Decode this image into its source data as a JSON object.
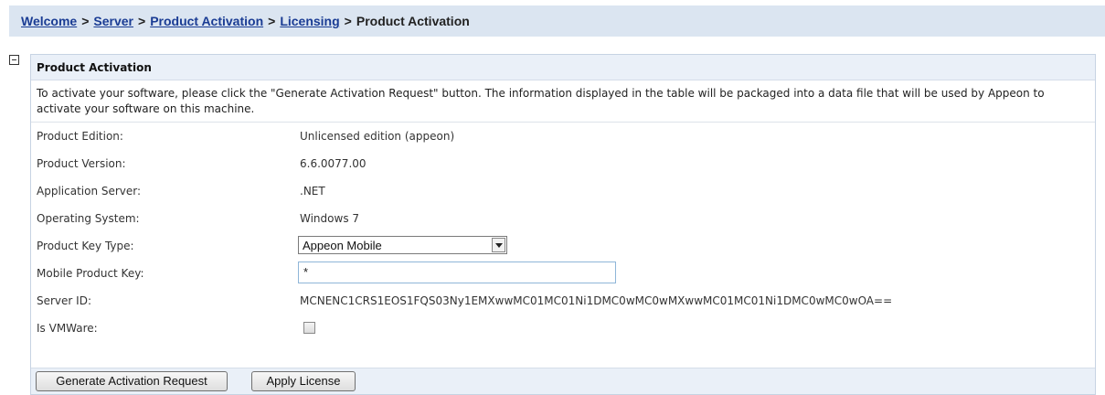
{
  "breadcrumb": {
    "items": [
      {
        "label": "Welcome",
        "link": true
      },
      {
        "label": "Server",
        "link": true
      },
      {
        "label": "Product Activation",
        "link": true
      },
      {
        "label": "Licensing",
        "link": true
      },
      {
        "label": "Product Activation",
        "link": false
      }
    ],
    "separator": ">"
  },
  "panel": {
    "title": "Product Activation",
    "description": "To activate your software, please click the \"Generate Activation Request\" button. The information displayed in the table will be packaged into a data file that will be used by Appeon to activate your software on this machine.",
    "fields": {
      "edition_label": "Product Edition:",
      "edition_value": "Unlicensed edition (appeon)",
      "version_label": "Product Version:",
      "version_value": "6.6.0077.00",
      "app_server_label": "Application Server:",
      "app_server_value": ".NET",
      "os_label": "Operating System:",
      "os_value": "Windows 7",
      "key_type_label": "Product Key Type:",
      "key_type_value": "Appeon Mobile",
      "mobile_key_label": "Mobile Product Key:",
      "mobile_key_value": "*",
      "server_id_label": "Server ID:",
      "server_id_value": "MCNENC1CRS1EOS1FQS03Ny1EMXwwMC01MC01Ni1DMC0wMC0wMXwwMC01MC01Ni1DMC0wMC0wOA==",
      "vmware_label": "Is VMWare:",
      "vmware_checked": false
    },
    "buttons": {
      "generate": "Generate Activation Request",
      "apply": "Apply License"
    }
  },
  "colors": {
    "breadcrumb_bg": "#dbe5f1",
    "link": "#1a3c94",
    "panel_header_bg": "#eaf0f8"
  }
}
